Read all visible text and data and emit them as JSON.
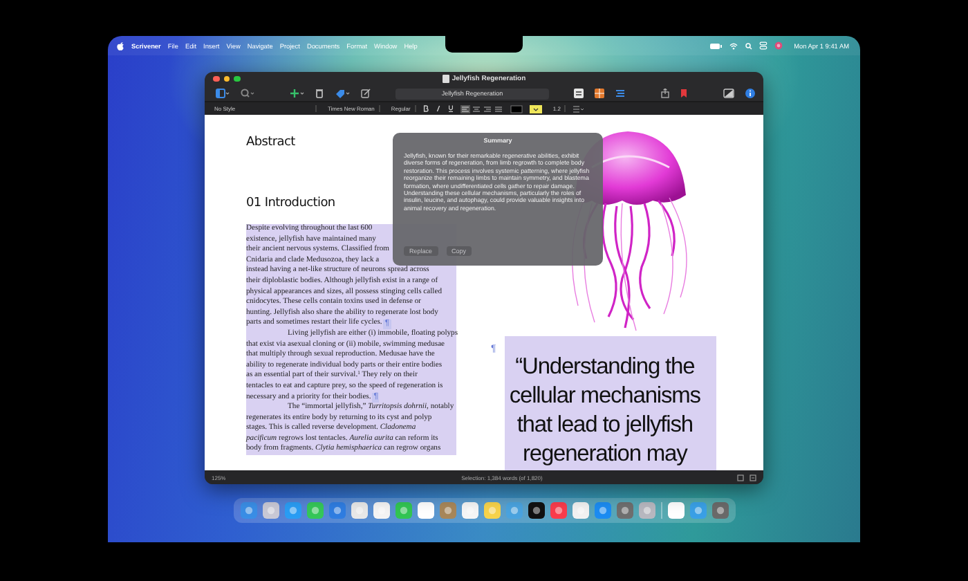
{
  "menu_bar": {
    "app_name": "Scrivener",
    "menus": [
      "File",
      "Edit",
      "Insert",
      "View",
      "Navigate",
      "Project",
      "Documents",
      "Format",
      "Window",
      "Help"
    ],
    "clock": "Mon Apr 1  9:41 AM"
  },
  "window": {
    "title": "Jellyfish Regeneration",
    "toolbar_title": "Jellyfish Regeneration",
    "format_bar": {
      "style": "No Style",
      "font": "Times New Roman",
      "weight": "Regular",
      "line_spacing": "1.2"
    },
    "document": {
      "headings": [
        "Abstract",
        "01 Introduction"
      ],
      "paragraphs": [
        {
          "indent": false,
          "mark": "¶",
          "lines": [
            "Despite evolving throughout the last 600",
            "existence, jellyfish have maintained many",
            "their ancient nervous systems. Classified from",
            "Cnidaria and clade Medusozoa, they lack a",
            "instead having a net-like structure of neurons spread across",
            "their diploblastic bodies. Although jellyfish exist in a range of",
            "physical appearances and sizes, all possess stinging cells called",
            "cnidocytes. These cells contain toxins used in defense or",
            "hunting. Jellyfish also share the ability to regenerate lost body",
            "parts and sometimes restart their life cycles."
          ]
        },
        {
          "indent": true,
          "mark": "¶",
          "lines": [
            "Living jellyfish are either (i) immobile, floating polyps",
            "that exist via asexual cloning or (ii) mobile, swimming medusae",
            "that multiply through sexual reproduction. Medusae have the",
            "ability to regenerate individual body parts or their entire bodies",
            "as an essential part of their survival.$^{1}$ They rely on their",
            "tentacles to eat and capture prey, so the speed of regeneration is",
            "necessary and a priority for their bodies."
          ]
        },
        {
          "indent": true,
          "lines": [
            "The “immortal jellyfish,” *Turritopsis dohrnii*, notably",
            "regenerates its entire body by returning to its cyst and polyp",
            "stages. This is called reverse development. *Cladonema*",
            "*pacificum* regrows lost tentacles. *Aurelia aurita* can reform its",
            "body from fragments. *Clytia hemisphaerica* can regrow organs"
          ]
        }
      ],
      "pull_quote": {
        "mark": "¶",
        "text": "“Understanding the cellular mechanisms that lead to jellyfish regeneration may"
      }
    },
    "summary_popover": {
      "title": "Summary",
      "text": "Jellyfish, known for their remarkable regenerative abilities, exhibit diverse forms of regeneration, from limb regrowth to complete body restoration. This process involves systemic patterning, where jellyfish reorganize their remaining limbs to maintain symmetry, and blastema formation, where undifferentiated cells gather to repair damage. Understanding these cellular mechanisms, particularly the roles of insulin, leucine, and autophagy, could provide valuable insights into animal recovery and regeneration.",
      "buttons": [
        {
          "label": "Replace",
          "disabled": true
        },
        {
          "label": "Copy",
          "disabled": true
        }
      ]
    },
    "status_bar": {
      "zoom": "125%",
      "selection": "Selection: 1,384 words (of 1,820)"
    }
  }
}
